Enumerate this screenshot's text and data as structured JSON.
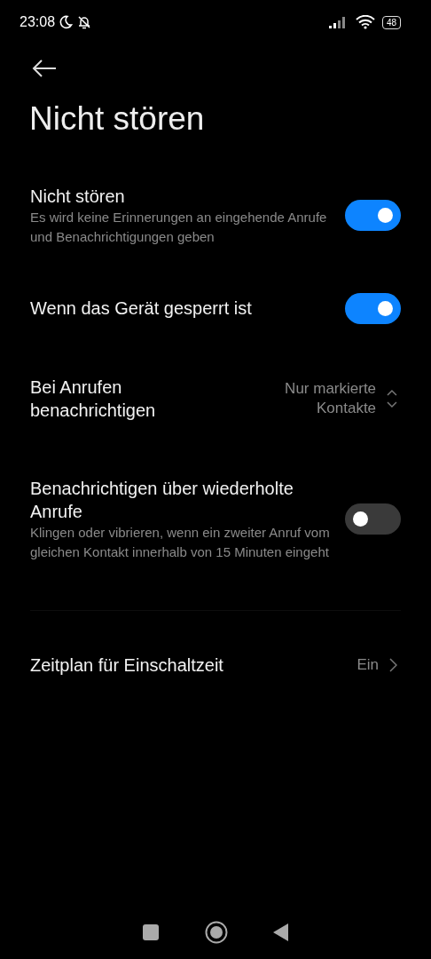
{
  "status_bar": {
    "time": "23:08",
    "battery": "48"
  },
  "title": "Nicht stören",
  "settings": [
    {
      "kind": "toggle",
      "label": "Nicht stören",
      "description": "Es wird keine Erinnerungen an eingehende Anrufe und Benachrichtigungen geben",
      "on": true
    },
    {
      "kind": "toggle",
      "label": "Wenn das Gerät gesperrt ist",
      "on": true
    },
    {
      "kind": "select",
      "label": "Bei Anrufen benachrichtigen",
      "value": "Nur markierte Kontakte"
    },
    {
      "kind": "toggle",
      "label": "Benachrichtigen über wiederholte Anrufe",
      "description": "Klingen oder vibrieren, wenn ein zweiter Anruf vom gleichen Kontakt innerhalb von 15 Minuten eingeht",
      "on": false
    },
    {
      "kind": "divider"
    },
    {
      "kind": "link",
      "label": "Zeitplan für Einschaltzeit",
      "value": "Ein"
    }
  ]
}
